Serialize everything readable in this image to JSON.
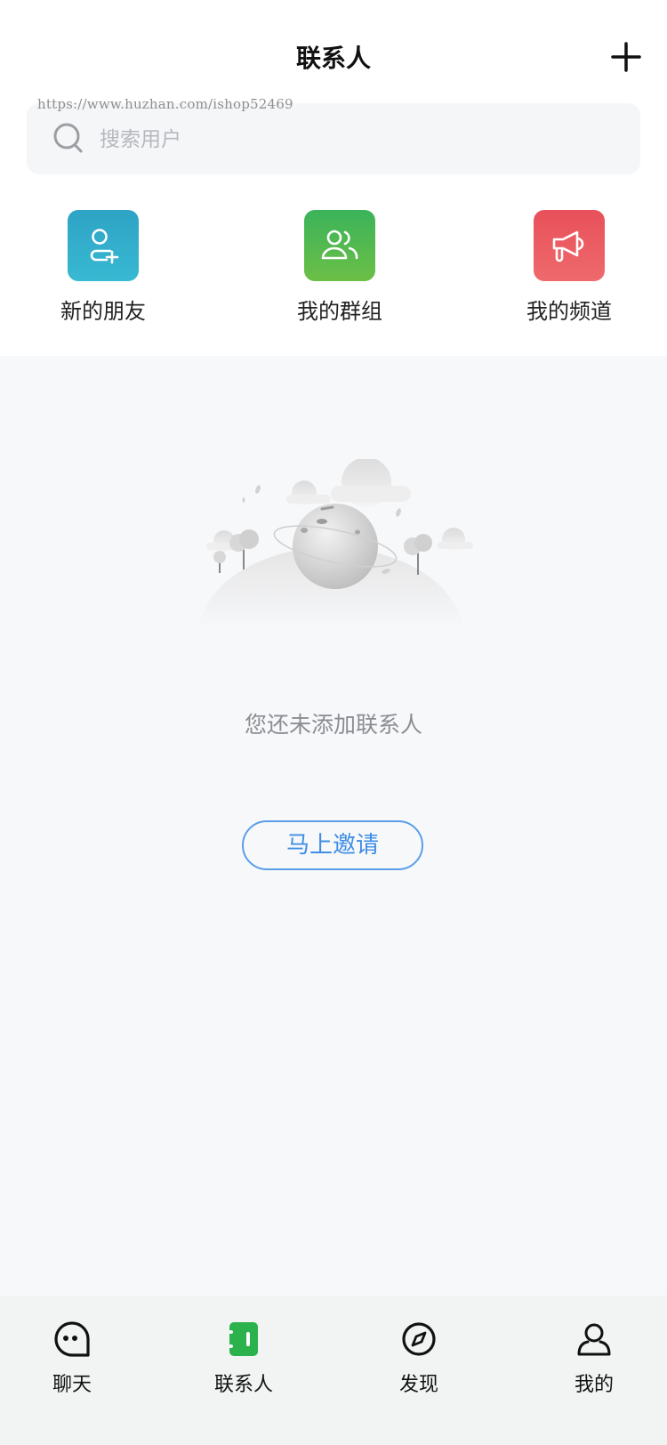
{
  "header": {
    "title": "联系人",
    "add_icon": "plus-icon"
  },
  "watermark": "https://www.huzhan.com/ishop52469",
  "search": {
    "placeholder": "搜索用户",
    "value": "",
    "icon": "search-icon"
  },
  "shortcuts": [
    {
      "label": "新的朋友",
      "icon": "add-user-icon",
      "color": "#33A9C9"
    },
    {
      "label": "我的群组",
      "icon": "group-icon",
      "color": "#4DB653"
    },
    {
      "label": "我的频道",
      "icon": "megaphone-icon",
      "color": "#EA5A60"
    }
  ],
  "empty_state": {
    "illustration": "planet-empty-illustration",
    "message": "您还未添加联系人",
    "invite_label": "马上邀请"
  },
  "tabbar": {
    "active_color": "#2BB24C",
    "items": [
      {
        "label": "聊天",
        "icon": "chat-icon",
        "active": false
      },
      {
        "label": "联系人",
        "icon": "contacts-book-icon",
        "active": true
      },
      {
        "label": "发现",
        "icon": "compass-icon",
        "active": false
      },
      {
        "label": "我的",
        "icon": "user-icon",
        "active": false
      }
    ]
  },
  "colors": {
    "accent_blue": "#3F8DE6",
    "page_background": "#F7F8FA"
  }
}
